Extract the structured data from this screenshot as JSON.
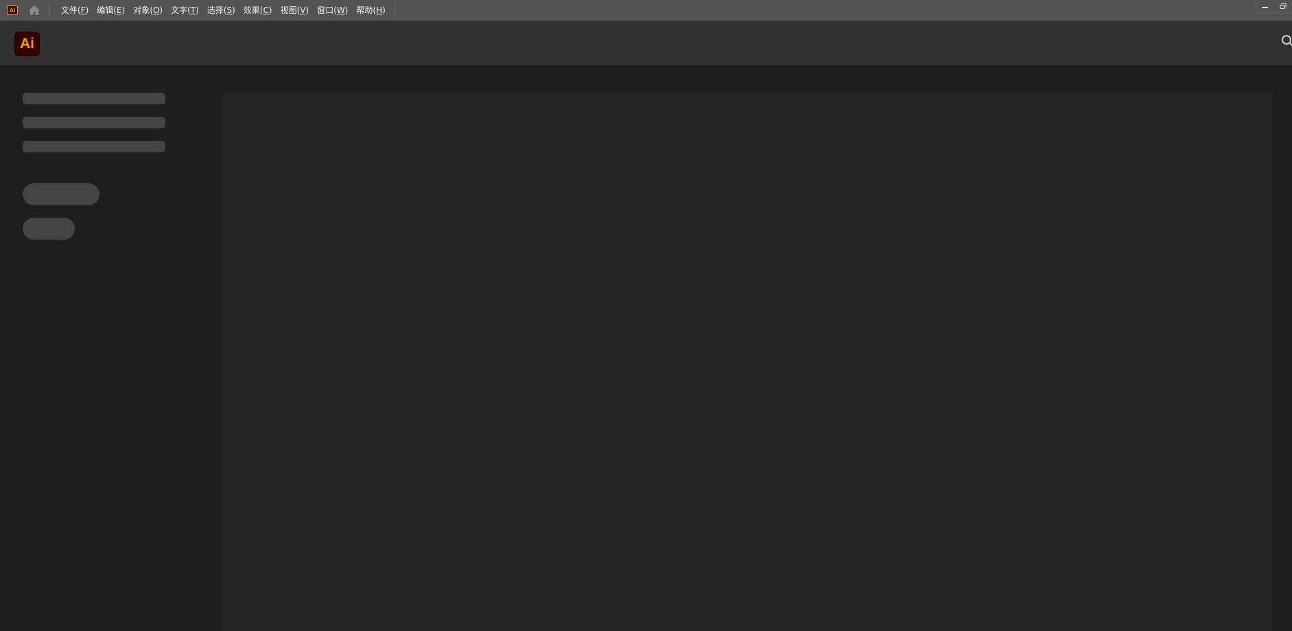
{
  "app": {
    "mini_logo_text": "Ai",
    "logo_text": "Ai",
    "brand_color": "#ff9a00",
    "brand_bg": "#330000"
  },
  "menubar": {
    "home_icon": "home-icon",
    "items": [
      {
        "label": "文件(",
        "mnemonic": "F",
        "close": ")"
      },
      {
        "label": "编辑(",
        "mnemonic": "E",
        "close": ")"
      },
      {
        "label": "对象(",
        "mnemonic": "O",
        "close": ")"
      },
      {
        "label": "文字(",
        "mnemonic": "T",
        "close": ")"
      },
      {
        "label": "选择(",
        "mnemonic": "S",
        "close": ")"
      },
      {
        "label": "效果(",
        "mnemonic": "C",
        "close": ")"
      },
      {
        "label": "视图(",
        "mnemonic": "V",
        "close": ")"
      },
      {
        "label": "窗口(",
        "mnemonic": "W",
        "close": ")"
      },
      {
        "label": "帮助(",
        "mnemonic": "H",
        "close": ")"
      }
    ]
  },
  "window_controls": {
    "minimize_icon": "minimize-icon",
    "restore_icon": "restore-icon"
  },
  "header": {
    "search_icon": "search-icon"
  },
  "colors": {
    "menubar_bg": "#535353",
    "header_bg": "#323232",
    "sidebar_bg": "#1e1e1e",
    "main_bg": "#252525",
    "skeleton": "#444444"
  }
}
